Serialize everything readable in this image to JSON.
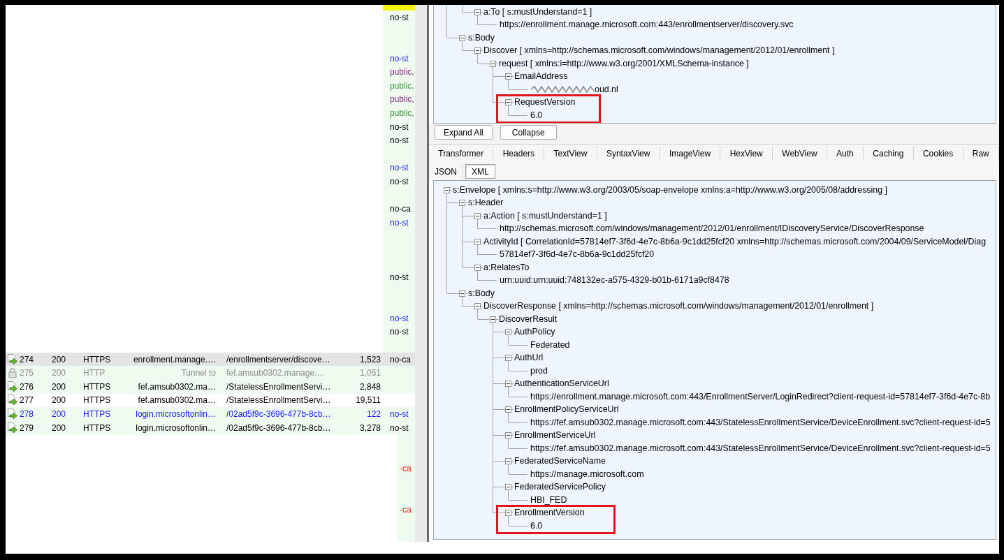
{
  "session_list": {
    "rows": [
      {
        "kind": "redacted",
        "selected": false,
        "marked": true
      },
      {
        "kind": "redacted",
        "selected": false,
        "marked": false,
        "shaded": true,
        "caching": "no-st"
      },
      {
        "kind": "redacted",
        "selected": false,
        "marked": false,
        "shaded": true
      },
      {
        "kind": "redacted",
        "selected": false,
        "marked": false,
        "shaded": true
      },
      {
        "kind": "redacted",
        "selected": false,
        "marked": false,
        "shaded": true,
        "caching": "no-st",
        "color": "#1a1aff"
      },
      {
        "kind": "redacted",
        "selected": false,
        "marked": false,
        "shaded": true,
        "caching": "public,",
        "color": "#8e2a8e"
      },
      {
        "kind": "redacted",
        "selected": false,
        "marked": false,
        "shaded": true,
        "caching": "public,",
        "color": "#3a963a"
      },
      {
        "kind": "redacted",
        "selected": false,
        "marked": false,
        "shaded": true,
        "caching": "public,",
        "color": "#8e2a8e"
      },
      {
        "kind": "redacted",
        "selected": false,
        "marked": false,
        "shaded": true,
        "caching": "public,",
        "color": "#3a963a"
      },
      {
        "kind": "redacted",
        "selected": false,
        "marked": false,
        "shaded": true,
        "caching": "no-st"
      },
      {
        "kind": "redacted",
        "selected": false,
        "marked": false,
        "shaded": true,
        "caching": "no-st"
      },
      {
        "kind": "redacted",
        "selected": false,
        "marked": false,
        "shaded": true
      },
      {
        "kind": "redacted",
        "selected": false,
        "marked": false,
        "shaded": true,
        "caching": "no-st",
        "color": "#1a1aff"
      },
      {
        "kind": "redacted",
        "selected": false,
        "marked": false,
        "shaded": true,
        "caching": "no-st"
      },
      {
        "kind": "redacted",
        "selected": false,
        "marked": false,
        "shaded": true
      },
      {
        "kind": "redacted",
        "selected": false,
        "marked": false,
        "shaded": true,
        "caching": "no-ca"
      },
      {
        "kind": "redacted",
        "selected": false,
        "marked": false,
        "shaded": true,
        "caching": "no-st",
        "color": "#1a1aff"
      },
      {
        "kind": "redacted",
        "selected": false,
        "marked": false,
        "shaded": true
      },
      {
        "kind": "redacted",
        "selected": false,
        "marked": false,
        "shaded": true
      },
      {
        "kind": "redacted",
        "selected": false,
        "marked": false,
        "shaded": true
      },
      {
        "kind": "redacted",
        "selected": false,
        "marked": false,
        "shaded": true,
        "caching": "no-st"
      },
      {
        "kind": "redacted",
        "selected": false,
        "marked": false,
        "shaded": true
      },
      {
        "kind": "redacted",
        "selected": false,
        "marked": false,
        "shaded": true
      },
      {
        "kind": "redacted",
        "selected": false,
        "marked": false,
        "shaded": true,
        "caching": "no-st",
        "color": "#1a1aff"
      },
      {
        "kind": "redacted",
        "selected": false,
        "marked": false,
        "shaded": true,
        "caching": "no-st"
      },
      {
        "kind": "redacted",
        "selected": false,
        "marked": false,
        "shaded": true
      },
      {
        "kind": "response",
        "selected": true,
        "number": "274",
        "result": "200",
        "protocol": "HTTPS",
        "host": "enrollment.manage.…",
        "url": "/enrollmentserver/discove…",
        "body": "1,523",
        "caching": "no-ca"
      },
      {
        "kind": "tunnel",
        "selected": false,
        "marked": false,
        "shaded": true,
        "number": "275",
        "result": "200",
        "protocol": "HTTP",
        "host": "Tunnel to",
        "url": "fef.amsub0302.manage.…",
        "body": "1,051",
        "color": "#8c8c8c"
      },
      {
        "kind": "response",
        "selected": false,
        "marked": false,
        "shaded": true,
        "number": "276",
        "result": "200",
        "protocol": "HTTPS",
        "host": "fef.amsub0302.ma…",
        "url": "/StatelessEnrollmentServi…",
        "body": "2,848"
      },
      {
        "kind": "response",
        "selected": false,
        "marked": false,
        "shaded": false,
        "number": "277",
        "result": "200",
        "protocol": "HTTPS",
        "host": "fef.amsub0302.ma…",
        "url": "/StatelessEnrollmentServi…",
        "body": "19,511"
      },
      {
        "kind": "response",
        "selected": false,
        "marked": false,
        "shaded": true,
        "number": "278",
        "result": "200",
        "protocol": "HTTPS",
        "host": "login.microsoftonlin…",
        "url": "/02ad5f9c-3696-477b-8cb…",
        "body": "122",
        "caching": "no-st",
        "color": "#1a1aff"
      },
      {
        "kind": "response",
        "selected": false,
        "marked": false,
        "shaded": true,
        "number": "279",
        "result": "200",
        "protocol": "HTTPS",
        "host": "login.microsoftonlin…",
        "url": "/02ad5f9c-3696-477b-8cb…",
        "body": "3,278",
        "caching": "no-st"
      },
      {
        "kind": "redacted_wide",
        "selected": false,
        "marked": false,
        "shaded": true
      },
      {
        "kind": "redacted_wide",
        "selected": false,
        "marked": false,
        "shaded": true
      },
      {
        "kind": "redacted_wide",
        "selected": false,
        "marked": false,
        "shaded": true,
        "caching": "-ca",
        "color": "#ff1a1a"
      },
      {
        "kind": "redacted_wide",
        "selected": false,
        "marked": false,
        "shaded": true
      },
      {
        "kind": "redacted_wide",
        "selected": false,
        "marked": false,
        "shaded": true
      },
      {
        "kind": "redacted_wide",
        "selected": false,
        "marked": false,
        "shaded": true,
        "caching": "-ca",
        "color": "#ff1a1a"
      },
      {
        "kind": "redacted_wide",
        "selected": false,
        "marked": false,
        "shaded": true
      },
      {
        "kind": "redacted_wide",
        "selected": false,
        "marked": false,
        "shaded": true
      }
    ]
  },
  "request_tree": {
    "nodes": [
      {
        "children": [
          {
            "children": [
              {
                "label": "a:To [ s:mustUnderstand=1 ]",
                "expanded": true,
                "highlighted": false,
                "children": [
                  {
                    "label": "https://enrollment.manage.microsoft.com:443/enrollmentserver/discovery.svc"
                  }
                ]
              }
            ]
          },
          {
            "label": "s:Body",
            "expanded": true,
            "highlighted": false,
            "children": [
              {
                "label": "Discover [ xmlns=http://schemas.microsoft.com/windows/management/2012/01/enrollment ]",
                "expanded": true,
                "highlighted": false,
                "children": [
                  {
                    "label": "request [ xmlns:i=http://www.w3.org/2001/XMLSchema-instance ]",
                    "expanded": true,
                    "highlighted": false,
                    "children": [
                      {
                        "label": "EmailAddress",
                        "expanded": true,
                        "highlighted": false,
                        "children": [
                          {
                            "label": "oud.nl",
                            "redacted": true
                          }
                        ]
                      },
                      {
                        "label": "RequestVersion",
                        "expanded": true,
                        "highlighted": true,
                        "children": [
                          {
                            "label": "6.0"
                          }
                        ]
                      }
                    ]
                  }
                ]
              }
            ]
          }
        ]
      }
    ]
  },
  "tree_buttons": [
    "Expand All",
    "Collapse"
  ],
  "tab_rows": [
    {
      "tabs": [
        {
          "label": "Transformer",
          "selected": false
        },
        {
          "label": "Headers",
          "selected": false
        },
        {
          "label": "TextView",
          "selected": false
        },
        {
          "label": "SyntaxView",
          "selected": false
        },
        {
          "label": "ImageView",
          "selected": false
        },
        {
          "label": "HexView",
          "selected": false
        },
        {
          "label": "WebView",
          "selected": false
        },
        {
          "label": "Auth",
          "selected": false
        },
        {
          "label": "Caching",
          "selected": false
        },
        {
          "label": "Cookies",
          "selected": false
        },
        {
          "label": "Raw",
          "selected": false
        }
      ]
    },
    {
      "tabs": [
        {
          "label": "JSON",
          "selected": false
        },
        {
          "label": "XML",
          "selected": true
        }
      ]
    }
  ],
  "response_tree": {
    "nodes": [
      {
        "label": "s:Envelope [ xmlns:s=http://www.w3.org/2003/05/soap-envelope xmlns:a=http://www.w3.org/2005/08/addressing ]",
        "expanded": true,
        "highlighted": false,
        "children": [
          {
            "label": "s:Header",
            "expanded": true,
            "highlighted": false,
            "children": [
              {
                "label": "a:Action [ s:mustUnderstand=1 ]",
                "expanded": true,
                "highlighted": false,
                "children": [
                  {
                    "label": "http://schemas.microsoft.com/windows/management/2012/01/enrollment/IDiscoveryService/DiscoverResponse"
                  }
                ]
              },
              {
                "label": "ActivityId [ CorrelationId=57814ef7-3f6d-4e7c-8b6a-9c1dd25fcf20 xmlns=http://schemas.microsoft.com/2004/09/ServiceModel/Diag",
                "expanded": true,
                "highlighted": false,
                "children": [
                  {
                    "label": "57814ef7-3f6d-4e7c-8b6a-9c1dd25fcf20"
                  }
                ]
              },
              {
                "label": "a:RelatesTo",
                "expanded": true,
                "highlighted": false,
                "children": [
                  {
                    "label": "urn:uuid:urn:uuid:748132ec-a575-4329-b01b-6171a9cf8478"
                  }
                ]
              }
            ]
          },
          {
            "label": "s:Body",
            "expanded": true,
            "highlighted": false,
            "children": [
              {
                "label": "DiscoverResponse [ xmlns=http://schemas.microsoft.com/windows/management/2012/01/enrollment ]",
                "expanded": true,
                "highlighted": false,
                "children": [
                  {
                    "label": "DiscoverResult",
                    "expanded": true,
                    "highlighted": false,
                    "children": [
                      {
                        "label": "AuthPolicy",
                        "expanded": true,
                        "highlighted": false,
                        "children": [
                          {
                            "label": "Federated"
                          }
                        ]
                      },
                      {
                        "label": "AuthUrl",
                        "expanded": true,
                        "highlighted": false,
                        "children": [
                          {
                            "label": "prod"
                          }
                        ]
                      },
                      {
                        "label": "AuthenticationServiceUrl",
                        "expanded": true,
                        "highlighted": false,
                        "children": [
                          {
                            "label": "https://enrollment.manage.microsoft.com:443/EnrollmentServer/LoginRedirect?client-request-id=57814ef7-3f6d-4e7c-8b"
                          }
                        ]
                      },
                      {
                        "label": "EnrollmentPolicyServiceUrl",
                        "expanded": true,
                        "highlighted": false,
                        "children": [
                          {
                            "label": "https://fef.amsub0302.manage.microsoft.com:443/StatelessEnrollmentService/DeviceEnrollment.svc?client-request-id=5"
                          }
                        ]
                      },
                      {
                        "label": "EnrollmentServiceUrl",
                        "expanded": true,
                        "highlighted": false,
                        "children": [
                          {
                            "label": "https://fef.amsub0302.manage.microsoft.com:443/StatelessEnrollmentService/DeviceEnrollment.svc?client-request-id=5"
                          }
                        ]
                      },
                      {
                        "label": "FederatedServiceName",
                        "expanded": true,
                        "highlighted": false,
                        "children": [
                          {
                            "label": "https://manage.microsoft.com"
                          }
                        ]
                      },
                      {
                        "label": "FederatedServicePolicy",
                        "expanded": true,
                        "highlighted": false,
                        "children": [
                          {
                            "label": "HBI_FED"
                          }
                        ]
                      },
                      {
                        "label": "EnrollmentVersion",
                        "expanded": true,
                        "highlighted": true,
                        "children": [
                          {
                            "label": "6.0"
                          }
                        ]
                      }
                    ]
                  }
                ]
              }
            ]
          }
        ]
      }
    ]
  }
}
